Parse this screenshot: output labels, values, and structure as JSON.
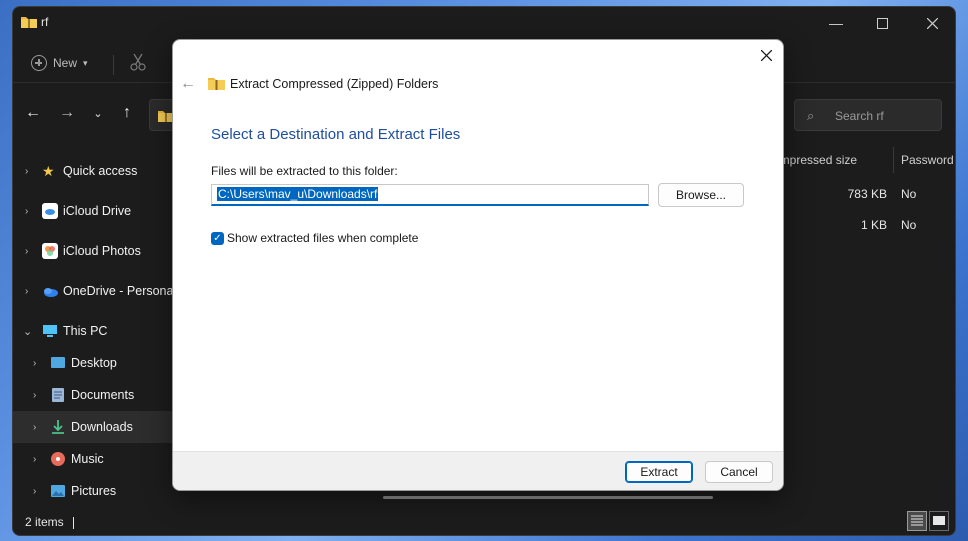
{
  "explorer": {
    "title": "rf",
    "toolbar": {
      "new_label": "New"
    },
    "search": {
      "placeholder": "Search rf"
    },
    "sidebar": {
      "items": [
        {
          "label": "Quick access",
          "icon": "star-icon"
        },
        {
          "label": "iCloud Drive",
          "icon": "icloud-icon"
        },
        {
          "label": "iCloud Photos",
          "icon": "photos-icon"
        },
        {
          "label": "OneDrive - Personal",
          "icon": "onedrive-icon"
        },
        {
          "label": "This PC",
          "icon": "pc-icon"
        },
        {
          "label": "Desktop",
          "icon": "desktop-icon"
        },
        {
          "label": "Documents",
          "icon": "documents-icon"
        },
        {
          "label": "Downloads",
          "icon": "download-icon"
        },
        {
          "label": "Music",
          "icon": "music-icon"
        },
        {
          "label": "Pictures",
          "icon": "pictures-icon"
        }
      ]
    },
    "columns": {
      "compressed_size": "ompressed size",
      "password": "Password"
    },
    "rows": [
      {
        "size": "783 KB",
        "password": "No"
      },
      {
        "size": "1 KB",
        "password": "No"
      }
    ],
    "status": {
      "count": "2 items"
    }
  },
  "dialog": {
    "title": "Extract Compressed (Zipped) Folders",
    "heading": "Select a Destination and Extract Files",
    "label": "Files will be extracted to this folder:",
    "path": "C:\\Users\\mav_u\\Downloads\\rf",
    "browse_label": "Browse...",
    "checkbox_label": "Show extracted files when complete",
    "checkbox_checked": true,
    "extract_label": "Extract",
    "cancel_label": "Cancel"
  },
  "colors": {
    "accent": "#0067c0",
    "heading": "#1e4e9c",
    "explorer_bg": "#1c1c1c"
  }
}
